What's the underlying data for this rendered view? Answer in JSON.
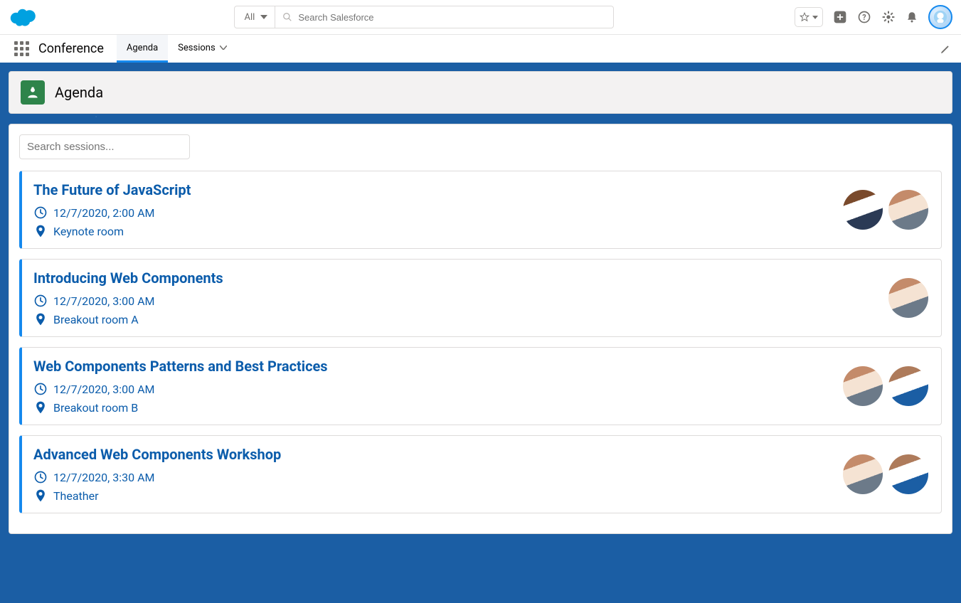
{
  "header": {
    "search_scope": "All",
    "search_placeholder": "Search Salesforce"
  },
  "nav": {
    "app_name": "Conference",
    "tabs": [
      {
        "label": "Agenda",
        "active": true
      },
      {
        "label": "Sessions",
        "active": false
      }
    ]
  },
  "page": {
    "title": "Agenda",
    "session_search_placeholder": "Search sessions..."
  },
  "sessions": [
    {
      "title": "The Future of JavaScript",
      "datetime": "12/7/2020, 2:00 AM",
      "room": "Keynote room",
      "speaker_tones": [
        "tone-a",
        "tone-b"
      ]
    },
    {
      "title": "Introducing Web Components",
      "datetime": "12/7/2020, 3:00 AM",
      "room": "Breakout room A",
      "speaker_tones": [
        "tone-b"
      ]
    },
    {
      "title": "Web Components Patterns and Best Practices",
      "datetime": "12/7/2020, 3:00 AM",
      "room": "Breakout room B",
      "speaker_tones": [
        "tone-b",
        "tone-c"
      ]
    },
    {
      "title": "Advanced Web Components Workshop",
      "datetime": "12/7/2020, 3:30 AM",
      "room": "Theather",
      "speaker_tones": [
        "tone-b",
        "tone-c"
      ]
    }
  ]
}
